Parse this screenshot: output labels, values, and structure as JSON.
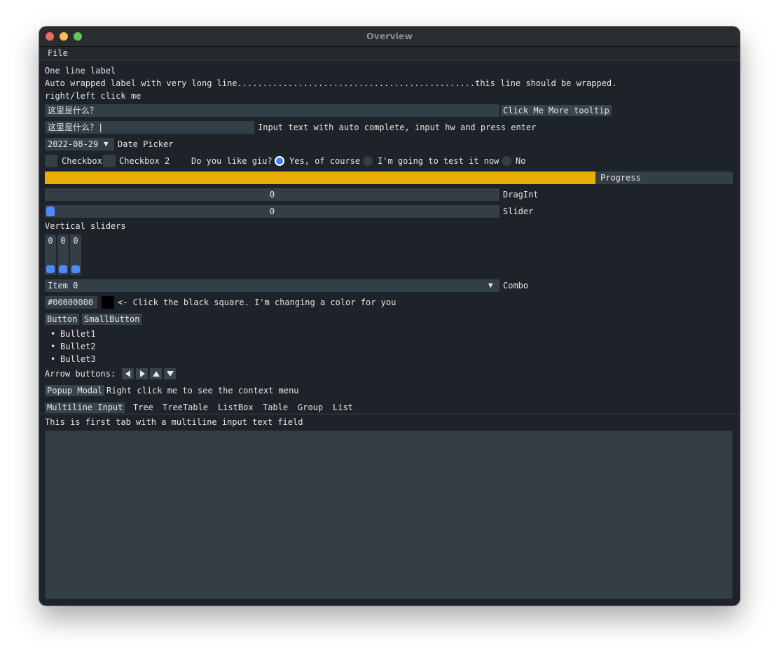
{
  "window": {
    "title": "Overview"
  },
  "menubar": {
    "file": "File"
  },
  "labels": {
    "one_line": "One line label",
    "wrapped": "Auto wrapped label with very long line...............................................this line should be wrapped.",
    "click_me": "right/left click me"
  },
  "row1": {
    "input_value": "这里是什么？",
    "click_button": "Click Me",
    "tooltip_button": "More tooltip"
  },
  "autocomplete": {
    "value": "这里是什么？|",
    "label": "Input text with auto complete, input hw and press enter"
  },
  "datepicker": {
    "value": "2022-08-29",
    "label": "Date Picker"
  },
  "checks": {
    "checkbox1": "Checkbox",
    "checkbox2": "Checkbox 2",
    "question": "Do you like giu?",
    "radio_yes": "Yes, of course",
    "radio_test": "I'm going to test it now",
    "radio_no": "No",
    "selected_radio": "Yes, of course"
  },
  "progress": {
    "label": "Progress",
    "fraction": 0.8
  },
  "dragint": {
    "value": "0",
    "label": "DragInt"
  },
  "slider": {
    "value": "0",
    "label": "Slider"
  },
  "vsliders": {
    "label": "Vertical sliders",
    "values": [
      "0",
      "0",
      "0"
    ]
  },
  "combo": {
    "value": "Item 0",
    "label": "Combo"
  },
  "color": {
    "hex": "#00000000",
    "swatch_color": "#000000",
    "label": "<- Click the black square. I'm changing a color for you"
  },
  "buttons": {
    "button": "Button",
    "small_button": "SmallButton"
  },
  "bullets": [
    "Bullet1",
    "Bullet2",
    "Bullet3"
  ],
  "arrows": {
    "label": "Arrow buttons:"
  },
  "popup": {
    "button": "Popup Modal",
    "context_label": "Right click me to see the context menu"
  },
  "tabs": [
    "Multiline Input",
    "Tree",
    "TreeTable",
    "ListBox",
    "Table",
    "Group",
    "List"
  ],
  "active_tab": "Multiline Input",
  "tab_content": {
    "text": "This is first tab with a multiline input text field",
    "multiline_value": ""
  },
  "colors": {
    "accent": "#4a8cff",
    "progress": "#e7ae08",
    "window_bg": "#1d2328",
    "frame_bg": "#333e47"
  }
}
